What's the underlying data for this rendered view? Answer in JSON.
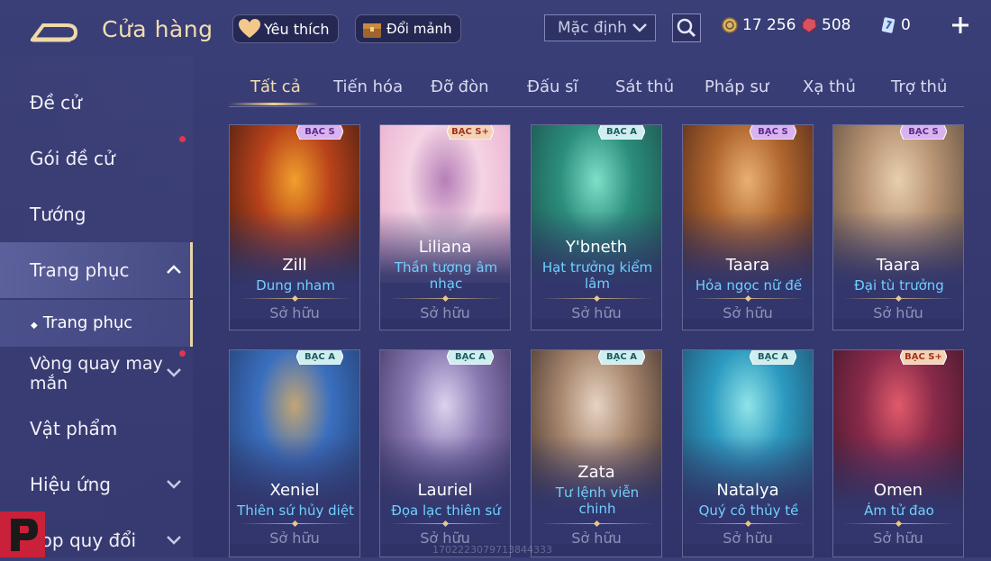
{
  "header": {
    "title": "Cửa hàng",
    "favorites_label": "Yêu thích",
    "fragments_label": "Đổi mảnh",
    "sort_value": "Mặc định",
    "currency": [
      {
        "icon": "gold-coin-icon",
        "value": "17 256"
      },
      {
        "icon": "red-gem-icon",
        "value": "508"
      },
      {
        "icon": "voucher-icon",
        "value": "0"
      }
    ]
  },
  "sidebar": {
    "items": [
      {
        "label": "Đề cử"
      },
      {
        "label": "Gói đề cử"
      },
      {
        "label": "Tướng"
      },
      {
        "label": "Trang phục"
      },
      {
        "label": "Vòng quay may mắn"
      },
      {
        "label": "Vật phẩm"
      },
      {
        "label": "Hiệu ứng"
      },
      {
        "label": "hop quy đổi"
      }
    ],
    "sub_item": "Trang phục"
  },
  "tabs": [
    "Tất cả",
    "Tiến hóa",
    "Đỡ đòn",
    "Đấu sĩ",
    "Sát thủ",
    "Pháp sư",
    "Xạ thủ",
    "Trợ thủ"
  ],
  "cards": [
    {
      "hero": "Zill",
      "skin": "Dung nham",
      "tier": "BẠC S",
      "status": "Sở hữu"
    },
    {
      "hero": "Liliana",
      "skin": "Thần tượng âm nhạc",
      "tier": "BẠC S+",
      "status": "Sở hữu"
    },
    {
      "hero": "Y'bneth",
      "skin": "Hạt trưởng kiểm lâm",
      "tier": "BẠC A",
      "status": "Sở hữu"
    },
    {
      "hero": "Taara",
      "skin": "Hỏa ngọc nữ đế",
      "tier": "BẠC S",
      "status": "Sở hữu"
    },
    {
      "hero": "Taara",
      "skin": "Đại tù trưởng",
      "tier": "BẠC S",
      "status": "Sở hữu"
    },
    {
      "hero": "Xeniel",
      "skin": "Thiên sứ hủy diệt",
      "tier": "BẠC A",
      "status": "Sở hữu"
    },
    {
      "hero": "Lauriel",
      "skin": "Đọa lạc thiên sứ",
      "tier": "BẠC A",
      "status": "Sở hữu"
    },
    {
      "hero": "Zata",
      "skin": "Tư lệnh viễn chinh",
      "tier": "BẠC A",
      "status": "Sở hữu"
    },
    {
      "hero": "Natalya",
      "skin": "Quý cô thủy tề",
      "tier": "BẠC A",
      "status": "Sở hữu"
    },
    {
      "hero": "Omen",
      "skin": "Ám tử đao",
      "tier": "BẠC S+",
      "status": "Sở hữu"
    }
  ],
  "watermark": "1702223079713844333",
  "colors": {
    "accent_gold": "#f1ddb0",
    "skin_name_blue": "#6fd0ff",
    "notification_red": "#e2364a"
  }
}
